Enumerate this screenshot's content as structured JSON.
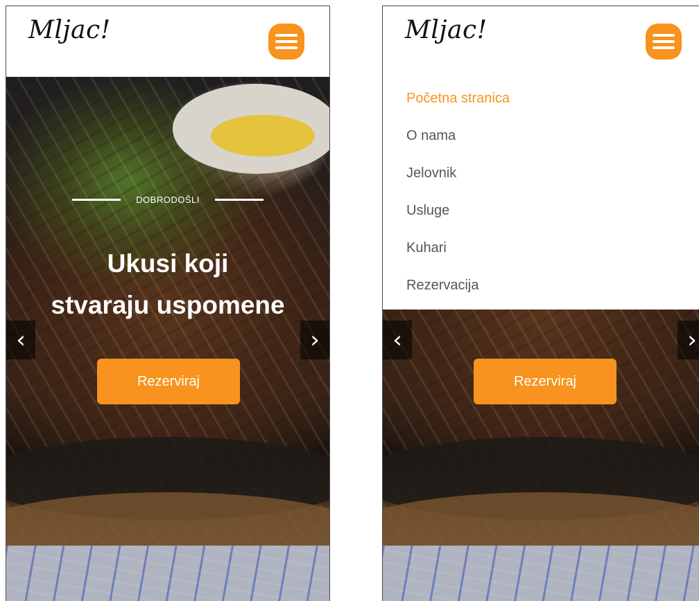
{
  "brand": {
    "logo_text": "Mljac!",
    "accent_color": "#f7931e"
  },
  "left_screen": {
    "menu_icon": "hamburger-icon",
    "hero": {
      "eyebrow": "DOBRODOŠLI",
      "title_line1": "Ukusi koji",
      "title_line2": "stvaraju uspomene",
      "cta": "Rezerviraj"
    },
    "carousel": {
      "prev_icon": "chevron-left-icon",
      "next_icon": "chevron-right-icon",
      "prev_glyph": "‹",
      "next_glyph": "›"
    }
  },
  "right_screen": {
    "menu_icon": "hamburger-icon",
    "nav": {
      "items": [
        {
          "label": "Početna stranica",
          "active": true
        },
        {
          "label": "O nama",
          "active": false
        },
        {
          "label": "Jelovnik",
          "active": false
        },
        {
          "label": "Usluge",
          "active": false
        },
        {
          "label": "Kuhari",
          "active": false
        },
        {
          "label": "Rezervacija",
          "active": false
        }
      ]
    },
    "hero": {
      "cta": "Rezerviraj"
    },
    "carousel": {
      "prev_glyph": "‹",
      "next_glyph": "›"
    }
  }
}
